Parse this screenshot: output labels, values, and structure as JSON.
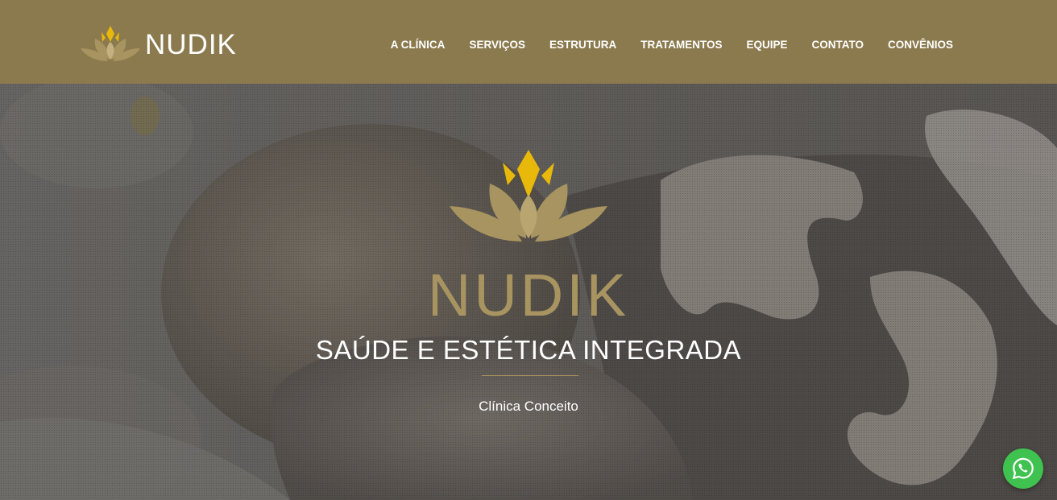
{
  "brand": {
    "name": "NUDIK",
    "logo_icon": "lotus-icon"
  },
  "nav": {
    "items": [
      {
        "label": "A CLÍNICA"
      },
      {
        "label": "SERVIÇOS"
      },
      {
        "label": "ESTRUTURA"
      },
      {
        "label": "TRATAMENTOS"
      },
      {
        "label": "EQUIPE"
      },
      {
        "label": "CONTATO"
      },
      {
        "label": "CONVÊNIOS"
      }
    ]
  },
  "hero": {
    "logo_icon": "lotus-icon",
    "brand_name": "NUDIK",
    "tagline": "SAÚDE E ESTÉTICA INTEGRADA",
    "subtitle": "Clínica Conceito",
    "background": "massage-photo"
  },
  "floating": {
    "whatsapp_icon": "whatsapp-icon"
  },
  "colors": {
    "header_bg": "#8b7a4e",
    "gold": "#a89460",
    "lotus_accent": "#e8b80a",
    "whatsapp_green": "#3fc24f",
    "text_white": "#ffffff"
  }
}
